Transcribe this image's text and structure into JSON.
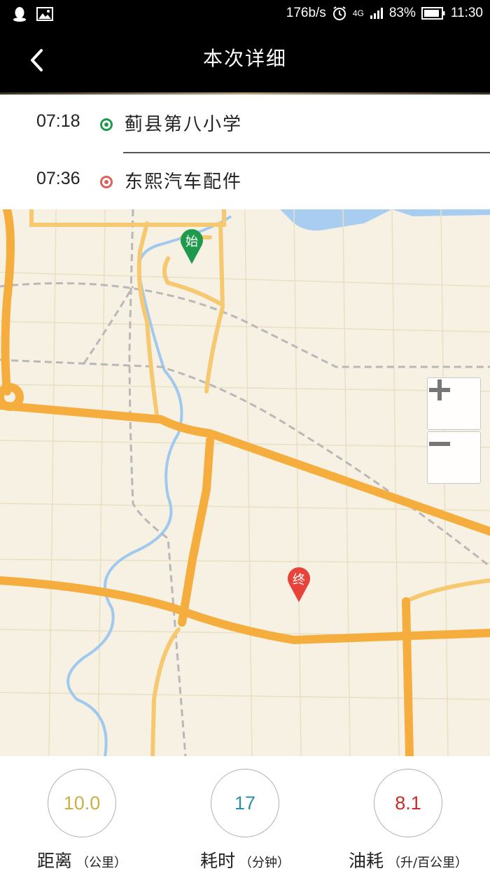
{
  "status_bar": {
    "network_speed": "176b/s",
    "signal": "4G",
    "battery": "83%",
    "time": "11:30",
    "left_icons": [
      "qq-icon",
      "image-icon"
    ]
  },
  "header": {
    "title": "本次详细",
    "back_icon": "chevron-left-icon"
  },
  "route": {
    "start": {
      "time": "07:18",
      "place": "蓟县第八小学",
      "color": "#1f9a4d"
    },
    "end": {
      "time": "07:36",
      "place": "东熙汽车配件",
      "color": "#e0605c"
    }
  },
  "map": {
    "start_marker": "始",
    "end_marker": "终",
    "zoom_in_icon": "plus-icon",
    "zoom_out_icon": "minus-icon",
    "road_color": "#f6b94d",
    "water_color": "#a8cdf0",
    "land_color": "#f6f1e2"
  },
  "stats": {
    "distance": {
      "value": "10.0",
      "label": "距离",
      "unit": "（公里）",
      "color": "#c9b046"
    },
    "duration": {
      "value": "17",
      "label": "耗时",
      "unit": "（分钟）",
      "color": "#2e8ea6"
    },
    "fuel": {
      "value": "8.1",
      "label": "油耗",
      "unit": "（升/百公里）",
      "color": "#c6302a"
    }
  }
}
